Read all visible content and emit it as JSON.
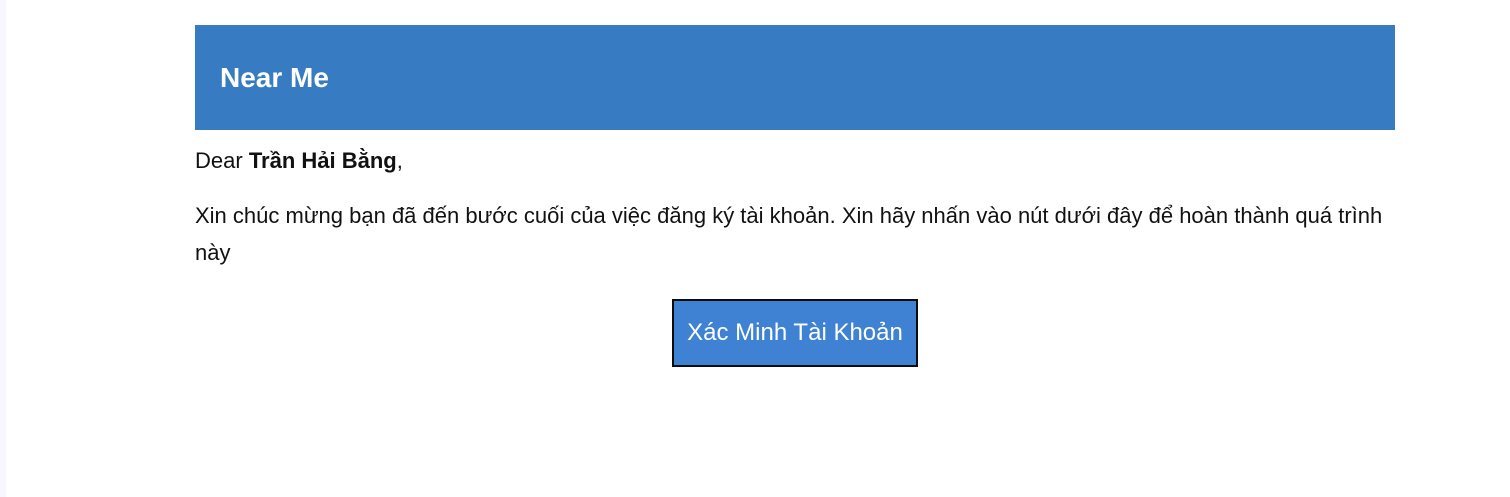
{
  "header": {
    "title": "Near Me",
    "background_color": "#377cc2"
  },
  "greeting": {
    "salutation": "Dear",
    "name": "Trần Hải Bằng",
    "punctuation": ","
  },
  "message": {
    "text": "Xin chúc mừng bạn đã đến bước cuối của việc đăng ký tài khoản. Xin hãy nhấn vào nút dưới đây để hoàn thành quá trình này"
  },
  "cta": {
    "label": "Xác Minh Tài Khoản",
    "background_color": "#3f82d4"
  }
}
